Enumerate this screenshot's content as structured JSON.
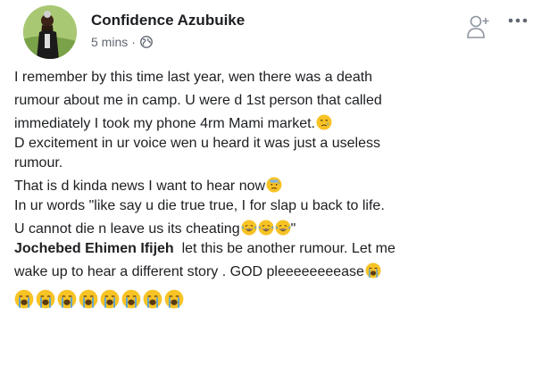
{
  "post": {
    "author": "Confidence Azubuike",
    "time": "5 mins",
    "separator": "·",
    "audience_icon": "globe-icon",
    "actions": {
      "add_friend_icon": "add-friend-icon",
      "more_icon": "more-horizontal-icon"
    },
    "lines": [
      "I remember by this time last year, wen there was a death",
      "rumour about me in camp. U were d 1st person that called",
      "immediately I took my phone 4rm Mami market.",
      "D excitement in ur voice wen u heard it was just a useless",
      "rumour.",
      "That is d kinda news I want to hear now",
      "In ur words \"like say u die true true, I for slap u back to life.",
      "U cannot die n leave us its cheating",
      "\""
    ]
  },
  "comment": {
    "author": "Jochebed Ehimen Ifijeh",
    "text_line1": "let this be another rumour. Let me",
    "text_line2": "wake up to hear a different story . GOD pleeeeeeeease",
    "emoji_count": 8
  },
  "emojis": {
    "crying": "crying-face-emoji",
    "sad_sweat": "downcast-sweat-emoji",
    "laugh_tears": "tears-of-joy-emoji",
    "loud_cry": "loudly-crying-emoji"
  },
  "colors": {
    "text": "#1c1e21",
    "meta": "#606770",
    "emoji_yellow": "#f7c325",
    "tear_blue": "#4ea0e6"
  }
}
